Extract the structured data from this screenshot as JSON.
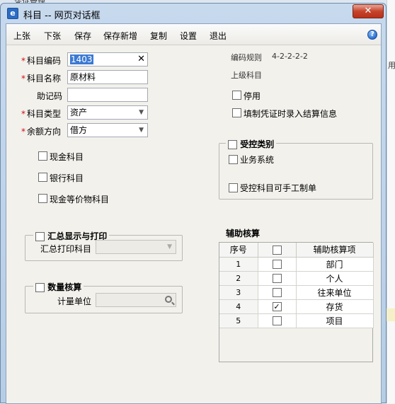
{
  "background": {
    "top_text": "凭证管理",
    "right_text": "用"
  },
  "window": {
    "title": "科目 -- 网页对话框",
    "close_icon": "✕"
  },
  "toolbar": {
    "items": [
      "上张",
      "下张",
      "保存",
      "保存新增",
      "复制",
      "设置",
      "退出"
    ],
    "help_icon": "?"
  },
  "form": {
    "code": {
      "label": "科目编码",
      "value": "1403",
      "clear": "✕"
    },
    "name": {
      "label": "科目名称",
      "value": "原材料"
    },
    "mnemonic": {
      "label": "助记码",
      "value": ""
    },
    "type": {
      "label": "科目类型",
      "value": "资产"
    },
    "balance": {
      "label": "余额方向",
      "value": "借方"
    },
    "required_mark": "*",
    "dropdown_icon": "▼",
    "cash": {
      "label": "现金科目",
      "checked": false
    },
    "bank": {
      "label": "银行科目",
      "checked": false
    },
    "cash_equiv": {
      "label": "现金等价物科目",
      "checked": false
    }
  },
  "right": {
    "rule_label": "编码规则",
    "rule_value": "4-2-2-2-2",
    "parent_label": "上级科目",
    "parent_value": "",
    "disabled": {
      "label": "停用",
      "checked": false
    },
    "settlement": {
      "label": "填制凭证时录入结算信息",
      "checked": false
    }
  },
  "controlled": {
    "title": "受控类别",
    "business": {
      "label": "业务系统",
      "checked": false
    },
    "manual": {
      "label": "受控科目可手工制单",
      "checked": false
    }
  },
  "summary": {
    "title": "汇总显示与打印",
    "print_label": "汇总打印科目",
    "print_value": ""
  },
  "quantity": {
    "title": "数量核算",
    "unit_label": "计量单位",
    "unit_value": ""
  },
  "aux": {
    "title": "辅助核算",
    "headers": [
      "序号",
      "",
      "辅助核算项"
    ],
    "rows": [
      {
        "no": "1",
        "checked": false,
        "item": "部门"
      },
      {
        "no": "2",
        "checked": false,
        "item": "个人"
      },
      {
        "no": "3",
        "checked": false,
        "item": "往来单位"
      },
      {
        "no": "4",
        "checked": true,
        "item": "存货"
      },
      {
        "no": "5",
        "checked": false,
        "item": "项目"
      }
    ],
    "check_glyph": "✓"
  }
}
